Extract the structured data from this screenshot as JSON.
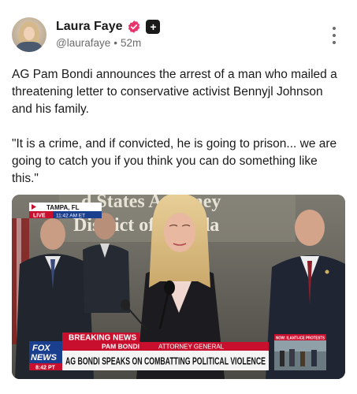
{
  "author": {
    "display_name": "Laura Faye",
    "handle": "@laurafaye",
    "separator": "•",
    "time": "52m",
    "plus_badge": "+",
    "avatar_icon": "avatar-photo",
    "verified_color": "#e8336d"
  },
  "post": {
    "paragraph_1": "AG Pam Bondi announces the arrest of a man who mailed a threatening letter to conservative activist Bennyjl Johnson and his family.",
    "paragraph_2": "\"It is a crime, and if convicted, he is going to prison... we are going to catch you if you think you can do something like this.\""
  },
  "media": {
    "wall_line_1": "d States Attorney",
    "wall_line_2": "District of Florida",
    "location": "TAMPA, FL",
    "live_label": "LIVE",
    "live_time": "11:42 AM ET",
    "breaking_label": "BREAKING NEWS",
    "speaker_name": "PAM BONDI",
    "speaker_title": "ATTORNEY GENERAL",
    "headline": "AG BONDI SPEAKS ON COMBATTING POLITICAL VIOLENCE",
    "network_line_1": "FOX",
    "network_line_2": "NEWS",
    "network_time": "8:42 PT",
    "inset_label": "NOW: ILANTI-ICE PROTESTS",
    "colors": {
      "fox_blue": "#1b3f8f",
      "breaking_red": "#c8102e",
      "chyron_white": "#f4f4f4"
    }
  }
}
